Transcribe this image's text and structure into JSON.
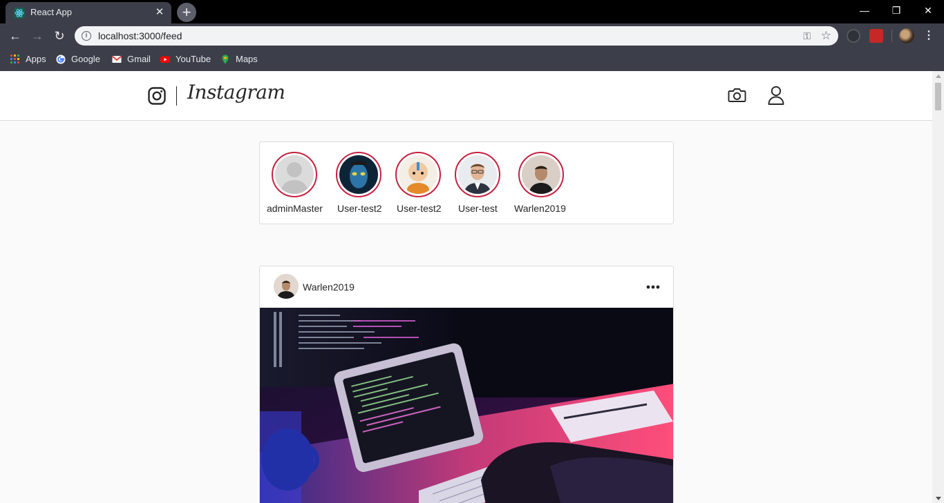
{
  "browser": {
    "tab_title": "React App",
    "url": "localhost:3000/feed",
    "bookmarks": [
      {
        "label": "Apps",
        "icon": "apps-grid-icon"
      },
      {
        "label": "Google",
        "icon": "google-icon"
      },
      {
        "label": "Gmail",
        "icon": "gmail-icon"
      },
      {
        "label": "YouTube",
        "icon": "youtube-icon"
      },
      {
        "label": "Maps",
        "icon": "maps-icon"
      }
    ]
  },
  "header": {
    "brand": "Instagram"
  },
  "stories": [
    {
      "username": "adminMaster",
      "avatar": "default-avatar"
    },
    {
      "username": "User-test2",
      "avatar": "avatar-blue-character"
    },
    {
      "username": "User-test2",
      "avatar": "avatar-cartoon-monk"
    },
    {
      "username": "User-test",
      "avatar": "avatar-man-suit"
    },
    {
      "username": "Warlen2019",
      "avatar": "avatar-man-photo"
    }
  ],
  "feed": {
    "posts": [
      {
        "username": "Warlen2019",
        "image": "developer-workstation-photo"
      }
    ]
  },
  "colors": {
    "story_ring": "#c7203f",
    "border": "#dbdbdb",
    "page_bg": "#fafafa",
    "text": "#262626"
  }
}
